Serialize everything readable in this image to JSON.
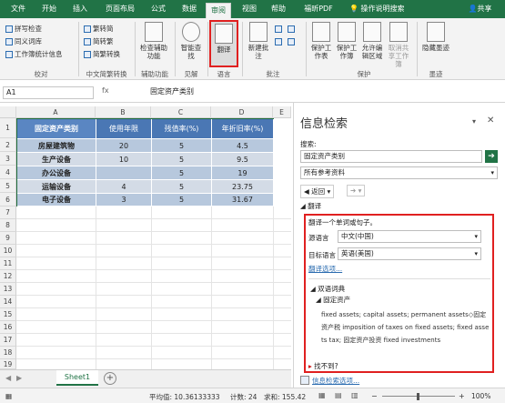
{
  "ribbon_tabs": [
    "文件",
    "开始",
    "插入",
    "页面布局",
    "公式",
    "数据",
    "审阅",
    "视图",
    "帮助",
    "福昕PDF",
    "操作说明搜索"
  ],
  "share": "共享",
  "ribbon": {
    "proofing": {
      "items": [
        "拼写检查",
        "同义词库",
        "工作簿统计信息"
      ],
      "label": "校对"
    },
    "chinese": {
      "items": [
        "繁转简",
        "简转繁",
        "简繁转换"
      ],
      "label": "中文简繁转换"
    },
    "accessibility": {
      "button": "检查辅助功能",
      "label": "辅助功能"
    },
    "insights": {
      "button": "智能查找",
      "label": "见解"
    },
    "language": {
      "button": "翻译",
      "label": "语言"
    },
    "comments": {
      "button": "新建批注",
      "label": "批注"
    },
    "protect": {
      "items": [
        "保护工作表",
        "保护工作簿",
        "允许编辑区域",
        "取消共享工作簿"
      ],
      "label": "保护"
    },
    "ink": {
      "button": "隐藏墨迹",
      "label": "墨迹"
    }
  },
  "namebox": "A1",
  "fx": "fx",
  "formula": "固定资产类别",
  "columns": [
    "A",
    "B",
    "C",
    "D",
    "E"
  ],
  "rows": [
    "1",
    "2",
    "3",
    "4",
    "5",
    "6",
    "7",
    "8",
    "9",
    "10",
    "11",
    "12",
    "13",
    "14",
    "15",
    "16",
    "17",
    "18",
    "19"
  ],
  "table": {
    "headers": [
      "固定资产类别",
      "使用年限",
      "残值率(%)",
      "年折旧率(%)"
    ],
    "data": [
      [
        "房屋建筑物",
        "20",
        "5",
        "4.5"
      ],
      [
        "生产设备",
        "10",
        "5",
        "9.5"
      ],
      [
        "办公设备",
        "",
        "5",
        "19"
      ],
      [
        "运输设备",
        "4",
        "5",
        "23.75"
      ],
      [
        "电子设备",
        "3",
        "5",
        "31.67"
      ]
    ]
  },
  "sheet_tab": "Sheet1",
  "status": {
    "avg": "平均值: 10.36133333",
    "count": "计数: 24",
    "sum": "求和: 155.42",
    "zoom": "100%"
  },
  "pane": {
    "title": "信息检索",
    "search_label": "搜索:",
    "search_value": "固定资产类别",
    "source": "所有参考资料",
    "back": "返回",
    "section": "翻译",
    "hint": "翻译一个单词或句子。",
    "from_label": "源语言",
    "from_value": "中文(中国)",
    "to_label": "目标语言",
    "to_value": "英语(美国)",
    "options": "翻译选项...",
    "dict_title": "双语词典",
    "entry": "固定资产",
    "definition": "fixed assets; capital assets; permanent assets◇固定资产税 imposition of taxes on fixed assets; fixed assets tax; 固定资产投资 fixed investments",
    "notfound": "找不到?",
    "options_link": "信息检索选项..."
  },
  "colors": {
    "accent": "#217346",
    "table_header": "#4a77b4",
    "highlight": "#e02020"
  }
}
